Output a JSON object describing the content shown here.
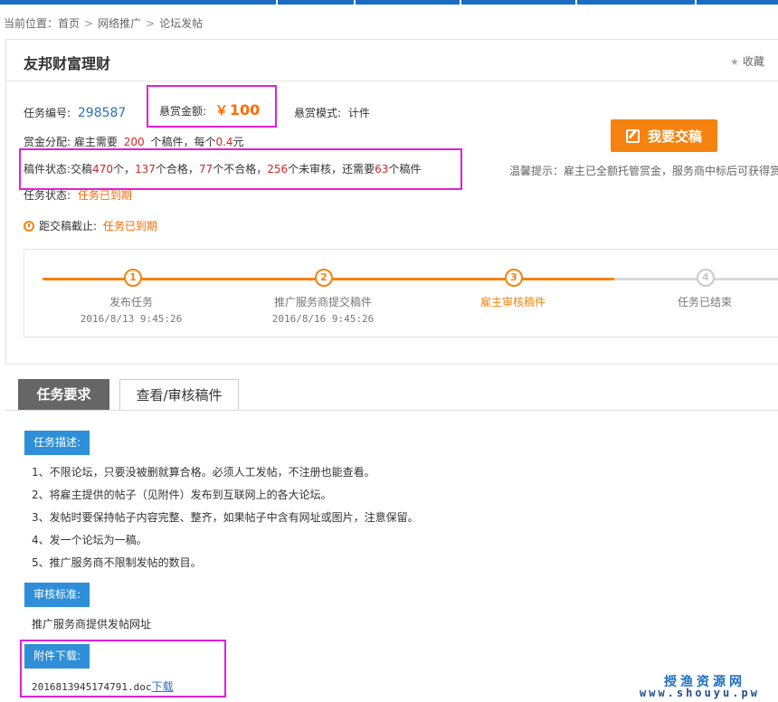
{
  "breadcrumb": {
    "prefix": "当前位置：",
    "items": [
      "首页",
      "网络推广",
      "论坛发帖"
    ],
    "separator": ">"
  },
  "task": {
    "title": "友邦财富理财",
    "favorite_label": "收藏",
    "id_label": "任务编号:",
    "id_value": "298587",
    "reward_label": "悬赏金额:",
    "reward_currency": "￥",
    "reward_value": "100",
    "mode_label": "悬赏模式:",
    "mode_value": "计件",
    "allocation": {
      "label": "赏金分配:",
      "text1": "雇主需要",
      "count": "200",
      "text2": "个稿件，每个",
      "price": "0.4",
      "unit": "元"
    },
    "draft_status": {
      "label": "稿件状态:",
      "t1": "交稿",
      "submitted": "470",
      "t2": "个，",
      "qualified": "137",
      "t3": "个合格，",
      "unqualified": "77",
      "t4": "个不合格，",
      "unreviewed": "256",
      "t5": "个未审核，还需要",
      "needed": "63",
      "t6": "个稿件"
    },
    "status_label": "任务状态:",
    "status_value": "任务已到期",
    "deadline_label": "距交稿截止:",
    "deadline_value": "任务已到期",
    "submit_button": "我要交稿",
    "tip": "温馨提示：雇主已全额托管赏金，服务商中标后可获得赏"
  },
  "steps": [
    {
      "num": "1",
      "label": "发布任务",
      "date": "2016/8/13 9:45:26"
    },
    {
      "num": "2",
      "label": "推广服务商提交稿件",
      "date": "2016/8/16 9:45:26"
    },
    {
      "num": "3",
      "label": "雇主审核稿件",
      "date": ""
    },
    {
      "num": "4",
      "label": "任务已结束",
      "date": ""
    }
  ],
  "tabs": [
    "任务要求",
    "查看/审核稿件"
  ],
  "requirements": {
    "desc_label": "任务描述:",
    "desc_items": [
      "1、不限论坛，只要没被删就算合格。必须人工发帖，不注册也能查看。",
      "2、将雇主提供的帖子（见附件）发布到互联网上的各大论坛。",
      "3、发帖时要保持帖子内容完整、整齐，如果帖子中含有网址或图片，注意保留。",
      "4、发一个论坛为一稿。",
      "5、推广服务商不限制发帖的数目。"
    ],
    "review_label": "审核标准:",
    "review_text": "推广服务商提供发帖网址",
    "attachment_label": "附件下载:",
    "attachment_file": "2016813945174791.doc",
    "attachment_link": "下载"
  },
  "watermark": {
    "line1": "授渔资源网",
    "line2": "www.shouyu.pw"
  },
  "colors": {
    "accent": "#f6830f",
    "brand_blue": "#1a6dc2",
    "label_blue": "#2e8fd8",
    "highlight": "#e21fd8",
    "red": "#d52525"
  }
}
